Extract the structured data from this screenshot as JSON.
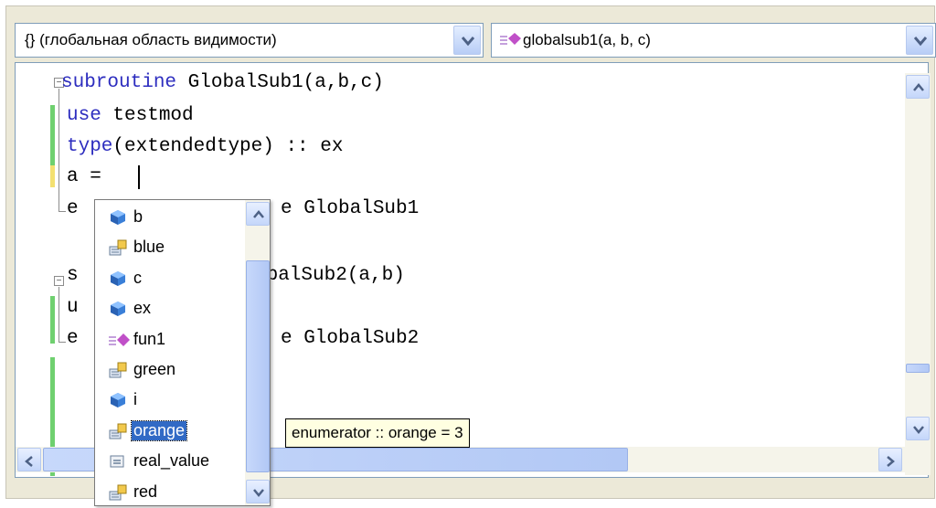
{
  "navigation": {
    "scope_icon": "{}",
    "scope_label": "(глобальная область видимости)",
    "member_label": "globalsub1(a, b, c)"
  },
  "editor": {
    "lines": {
      "l1_kw": "subroutine",
      "l1_rest": " GlobalSub1(a,b,c)",
      "l2_kw": "use",
      "l2_rest": " testmod",
      "l3_kw": "type",
      "l3_rest": "(extendedtype) :: ex",
      "l4": "a = ",
      "l5_visible_start": "e",
      "l5_visible_end": "e GlobalSub1",
      "l7_visible_start": "s",
      "l7_visible_end": "obalSub2(a,b)",
      "l8_visible_start": "u",
      "l9_visible_start": "e",
      "l9_visible_end": "e GlobalSub2"
    }
  },
  "completion": {
    "items": [
      {
        "label": "b",
        "icon": "variable-icon"
      },
      {
        "label": "blue",
        "icon": "enum-member-icon"
      },
      {
        "label": "c",
        "icon": "variable-icon"
      },
      {
        "label": "ex",
        "icon": "variable-icon"
      },
      {
        "label": "fun1",
        "icon": "function-icon"
      },
      {
        "label": "green",
        "icon": "enum-member-icon"
      },
      {
        "label": "i",
        "icon": "variable-icon"
      },
      {
        "label": "orange",
        "icon": "enum-member-icon",
        "selected": true
      },
      {
        "label": "real_value",
        "icon": "constant-icon"
      },
      {
        "label": "red",
        "icon": "enum-member-icon"
      }
    ],
    "tooltip": "enumerator :: orange = 3"
  },
  "colors": {
    "keyword": "#2d2dbf",
    "selection": "#316ac5",
    "tooltip_bg": "#ffffe1",
    "change_bar": "#6fd06f"
  }
}
